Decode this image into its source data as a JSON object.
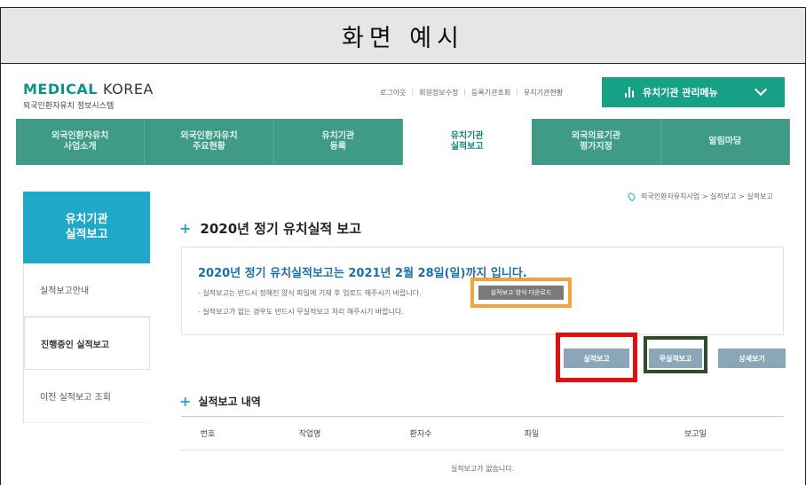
{
  "doc": {
    "title": "화면 예시",
    "top_logo": "KOREA"
  },
  "site": {
    "logo_main_bold": "MEDICAL",
    "logo_main_light": "KOREA",
    "logo_sub": "외국인환자유치 정보시스템",
    "util_links": [
      "로그아웃",
      "회원정보수정",
      "등록기관조회",
      "유치기관현황"
    ],
    "mgmt_menu_label": "유치기관 관리메뉴"
  },
  "gnb": [
    {
      "label": "외국인환자유치\n사업소개",
      "active": false
    },
    {
      "label": "외국인환자유치\n주요현황",
      "active": false
    },
    {
      "label": "유치기관\n등록",
      "active": false
    },
    {
      "label": "유치기관\n실적보고",
      "active": true
    },
    {
      "label": "외국의료기관\n평가지정",
      "active": false
    },
    {
      "label": "알림마당",
      "active": false
    }
  ],
  "sidebar": {
    "heading": "유치기관\n실적보고",
    "items": [
      {
        "label": "실적보고안내",
        "active": false
      },
      {
        "label": "진행중인 실적보고",
        "active": true
      },
      {
        "label": "이전 실적보고 조회",
        "active": false
      }
    ]
  },
  "breadcrumb": "외국인환자유치사업 > 실적보고 > 실적보고",
  "section_title": "2020년 정기 유치실적 보고",
  "notice": {
    "headline": "2020년 정기 유치실적보고는 2021년 2월 28일(일)까지 입니다.",
    "line1": "- 실적보고는 반드시 정해진 양식 파일에 기재 후 업로드 해주시기 바랍니다.",
    "line2": "- 실적보고가 없는 경우도 반드시 무실적보고 처리 해주시기 바랍니다.",
    "download_label": "실적보고 양식 다운로드"
  },
  "actions": {
    "report_label": "실적보고",
    "nil_report_label": "무실적보고",
    "detail_label": "상세보기"
  },
  "history": {
    "title": "실적보고 내역",
    "columns": [
      "번호",
      "작업명",
      "환자수",
      "파일",
      "보고일"
    ],
    "empty_message": "실적보고가 없습니다."
  },
  "colors": {
    "brand_green": "#16a085",
    "gnb_bg": "#3f9a86",
    "sidebar_accent": "#20a8c8",
    "highlight_orange": "#f2a33a",
    "highlight_red": "#e01010",
    "highlight_dark_green": "#2f4d2a"
  }
}
